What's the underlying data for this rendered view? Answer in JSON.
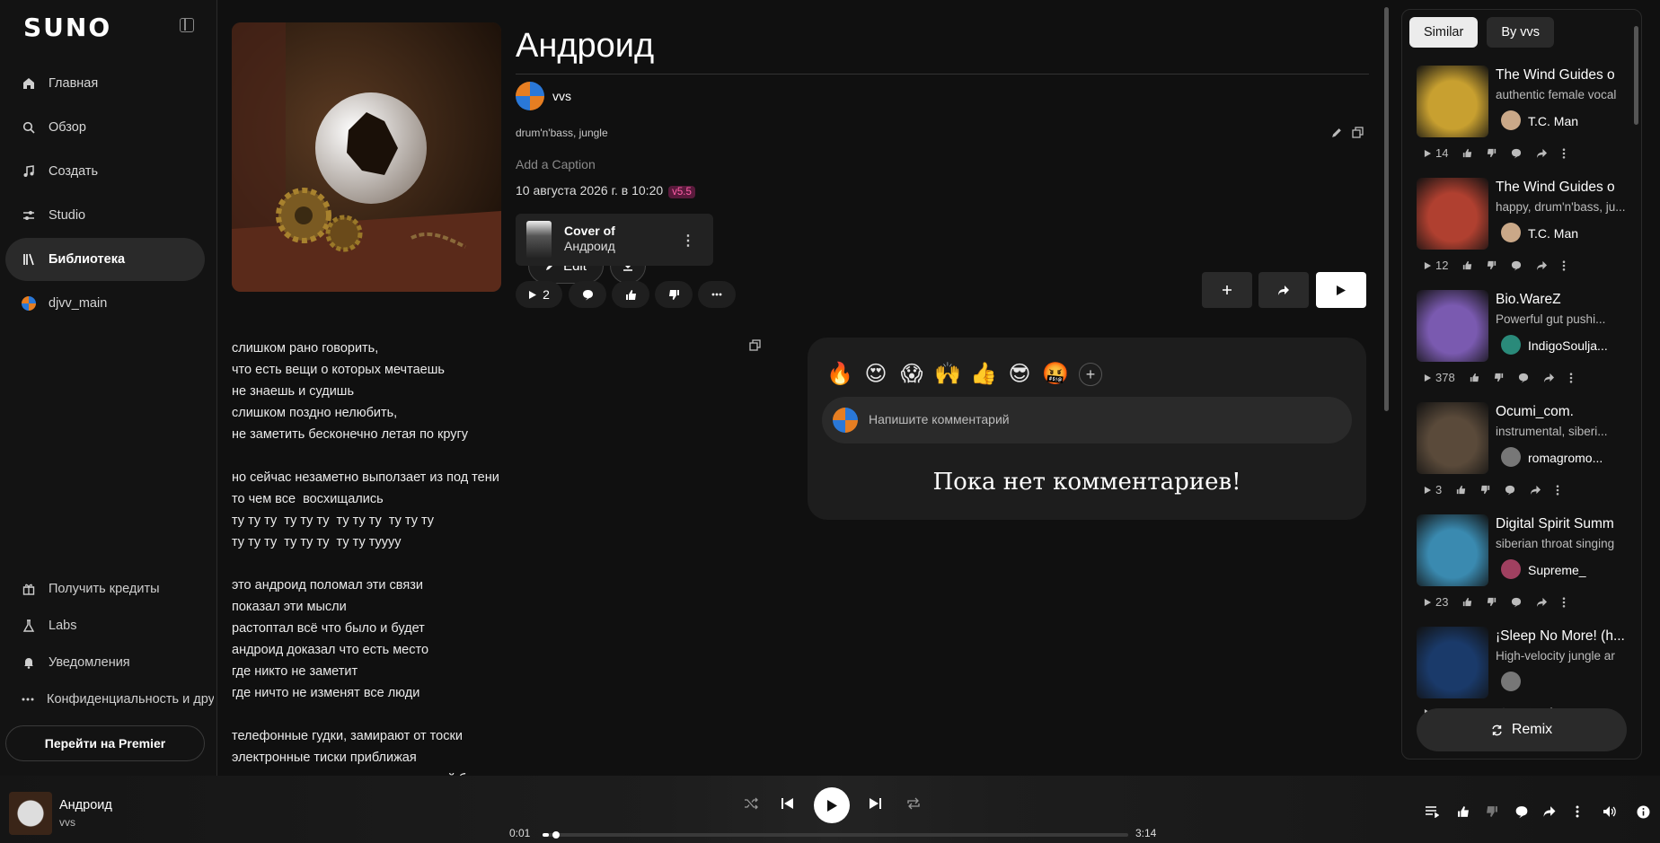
{
  "brand": "SUNO",
  "nav": [
    {
      "label": "Главная",
      "icon": "home-icon"
    },
    {
      "label": "Обзор",
      "icon": "search-icon"
    },
    {
      "label": "Создать",
      "icon": "music-note-icon"
    },
    {
      "label": "Studio",
      "icon": "studio-icon"
    },
    {
      "label": "Библиотека",
      "icon": "library-icon",
      "active": true
    },
    {
      "label": "djvv_main",
      "icon": "avatar"
    }
  ],
  "bottom_nav": [
    {
      "label": "Получить кредиты",
      "icon": "gift-icon"
    },
    {
      "label": "Labs",
      "icon": "flask-icon"
    },
    {
      "label": "Уведомления",
      "icon": "bell-icon"
    },
    {
      "label": "Конфиденциальность и другие",
      "icon": "more-icon"
    }
  ],
  "premier_label": "Перейти на Premier",
  "song": {
    "title": "Андроид",
    "artist": "vvs",
    "tags": "drum'n'bass, jungle",
    "caption_placeholder": "Add a Caption",
    "date": "10 августа 2026 г. в 10:20",
    "version": "v5.5",
    "plays": "2",
    "edit_label": "Edit",
    "cover_of_label": "Cover of",
    "cover_of_title": "Андроид"
  },
  "lyrics": "слишком рано говорить,\nчто есть вещи о которых мечтаешь\nне знаешь и судишь\nслишком поздно нелюбить,\nне заметить бесконечно летая по кругу\n\nно сейчас незаметно выползает из под тени\nто чем все  восхищались\nту ту ту  ту ту ту  ту ту ту  ту ту ту\nту ту ту  ту ту ту  ту ту туууу\n\nэто андроид поломал эти связи\nпоказал эти мысли\nрастоптал всё что было и будет\nандроид доказал что есть место\nгде никто не заметит\nгде ничто не изменят все люди\n\nтелефонные гудки, замирают от тоски\nэлектронные тиски приближая\nпеременя мост электронных мыслей близки",
  "comments": {
    "emojis": [
      "🔥",
      "😍",
      "😱",
      "🙌",
      "👍",
      "😎",
      "🤬"
    ],
    "placeholder": "Напишите комментарий",
    "empty_text": "Пока нет комментариев!"
  },
  "right_panel": {
    "tabs": [
      "Similar",
      "By vvs"
    ],
    "remix_label": "Remix",
    "items": [
      {
        "title": "The Wind Guides o",
        "subtitle": "authentic female vocal",
        "artist": "T.C. Man",
        "plays": "14",
        "img": "#c8a030",
        "avatar": "#caa888"
      },
      {
        "title": "The Wind Guides o",
        "subtitle": "happy, drum'n'bass, ju...",
        "artist": "T.C. Man",
        "plays": "12",
        "img": "#b04030",
        "avatar": "#caa888"
      },
      {
        "title": "Bio.WareZ",
        "subtitle": "Powerful gut pushi...",
        "artist": "IndigoSoulja...",
        "plays": "378",
        "img": "#7a5ab0",
        "avatar": "#2a8a7a"
      },
      {
        "title": "Ocumi_com.",
        "subtitle": "instrumental, siberi...",
        "artist": "romagromo...",
        "plays": "3",
        "img": "#5a4a3a",
        "avatar": "#777"
      },
      {
        "title": "Digital Spirit Summ",
        "subtitle": "siberian throat singing",
        "artist": "Supreme_",
        "plays": "23",
        "img": "#3a8ab0",
        "avatar": "#a04060"
      },
      {
        "title": "¡Sleep No More! (h...",
        "subtitle": "High-velocity jungle ar",
        "artist": "",
        "plays": "",
        "img": "#1a3a6a",
        "avatar": "#777"
      }
    ]
  },
  "player": {
    "title": "Андроид",
    "artist": "vvs",
    "current": "0:01",
    "duration": "3:14",
    "progress": 0.01
  }
}
